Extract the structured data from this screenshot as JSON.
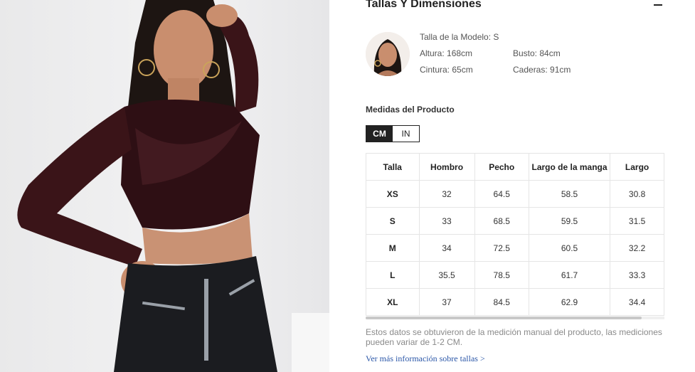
{
  "size_guide": {
    "title": "Tallas Y Dimensiones",
    "collapse_icon": "minus-icon"
  },
  "model": {
    "avatar_icon": "model-avatar",
    "size_label": "Talla de la Modelo: S",
    "height": "Altura: 168cm",
    "bust": "Busto: 84cm",
    "waist": "Cintura: 65cm",
    "hips": "Caderas: 91cm"
  },
  "measurements": {
    "title": "Medidas del Producto",
    "units": {
      "cm": "CM",
      "in": "IN",
      "selected": "CM"
    },
    "columns": [
      "Talla",
      "Hombro",
      "Pecho",
      "Largo de la manga",
      "Largo"
    ],
    "rows": [
      [
        "XS",
        "32",
        "64.5",
        "58.5",
        "30.8"
      ],
      [
        "S",
        "33",
        "68.5",
        "59.5",
        "31.5"
      ],
      [
        "M",
        "34",
        "72.5",
        "60.5",
        "32.2"
      ],
      [
        "L",
        "35.5",
        "78.5",
        "61.7",
        "33.3"
      ],
      [
        "XL",
        "37",
        "84.5",
        "62.9",
        "34.4"
      ]
    ]
  },
  "note": "Estos datos se obtuvieron de la medición manual del producto, las mediciones pueden variar de 1-2 CM.",
  "more_link": "Ver más información sobre tallas >",
  "colors": {
    "accent_dark": "#222222",
    "link": "#2b57a8",
    "top_garment": "#2e0f14",
    "pants": "#1b1c20"
  }
}
